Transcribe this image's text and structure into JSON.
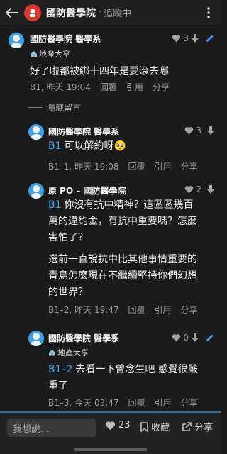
{
  "header": {
    "title": "國防醫學院",
    "separator": "·",
    "status": "追蹤中"
  },
  "hidden_label": "隱藏留言",
  "comments": [
    {
      "name": "國防醫學院 醫學系",
      "badge": "地產大亨",
      "reply_to": "",
      "lines": [
        "好了啦都被綁十四年是要滾去哪"
      ],
      "floor": "B1, 昨天 19:04",
      "reply": "回覆",
      "quote": "引用",
      "share": "分享",
      "likes": "3"
    },
    {
      "name": "國防醫學院 醫學系",
      "reply_to": "B1",
      "lines": [
        "可以解約呀🥺"
      ],
      "floor": "B1–1, 昨天 19:08",
      "reply": "回覆",
      "quote": "引用",
      "share": "分享",
      "likes": "3"
    },
    {
      "name": "原 PO – 國防醫學院",
      "reply_to": "B1",
      "lines": [
        "你沒有抗中精神？這區區幾百",
        "萬的違約金，有抗中重要嗎？怎麼",
        "害怕了？",
        "選前一直說抗中比其他事情重要的",
        "青鳥怎麼現在不繼續堅持你們幻想",
        "的世界？"
      ],
      "first_line_with_ref": "你沒有抗中精神？這區區幾百",
      "floor": "B1–2, 昨天 19:47",
      "reply": "回覆",
      "quote": "引用",
      "share": "分享",
      "likes": "2"
    },
    {
      "name": "國防醫學院 醫學系",
      "badge": "地產大亨",
      "reply_to": "B1–2",
      "lines": [
        "去看一下曾念生吧 感覺很嚴",
        "重了"
      ],
      "floor": "B1–3, 今天 03:47",
      "reply": "回覆",
      "quote": "引用",
      "share": "分享",
      "likes": "0"
    }
  ],
  "bottom_bar": {
    "input_placeholder": "我想說...",
    "likes": "23",
    "bookmark": "收藏",
    "share": "分享"
  }
}
